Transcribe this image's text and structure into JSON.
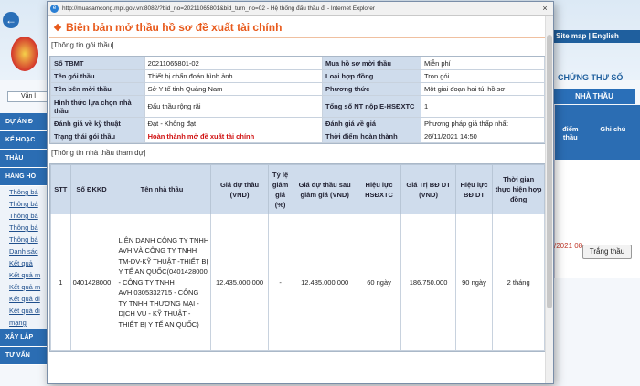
{
  "background": {
    "site_links": "Site map | English",
    "banner_text": "CHỨNG THƯ SỐ",
    "nav_button": "NHÀ THẦU",
    "search_value": "Văn l",
    "left_menu": [
      {
        "label": "DỰ ÁN Đ",
        "type": "head"
      },
      {
        "label": "KẾ HOẠC",
        "type": "head"
      },
      {
        "label": "THẦU",
        "type": "head"
      },
      {
        "label": "HÀNG HÓ",
        "type": "head"
      },
      {
        "label": "Thông bá",
        "type": "sub"
      },
      {
        "label": "Thông bá",
        "type": "sub"
      },
      {
        "label": "Thông bá",
        "type": "sub"
      },
      {
        "label": "Thông bá",
        "type": "sub"
      },
      {
        "label": "Thông bá",
        "type": "sub"
      },
      {
        "label": "Danh sác",
        "type": "sub"
      },
      {
        "label": "Kết quả",
        "type": "sub"
      },
      {
        "label": "Kết quả m",
        "type": "sub"
      },
      {
        "label": "Kết quả m",
        "type": "sub"
      },
      {
        "label": "Kết quả đi",
        "type": "sub"
      },
      {
        "label": "Kết quả đi",
        "type": "sub"
      },
      {
        "label": "mạng",
        "type": "sub"
      },
      {
        "label": "XÂY LẮP",
        "type": "head"
      },
      {
        "label": "TƯ VẤN",
        "type": "head"
      }
    ],
    "right_panel": {
      "col1": "điểm thầu",
      "col2": "Ghi chú",
      "date": "/2021 08",
      "button": "Trắng thầu"
    }
  },
  "window": {
    "title": "http://muasamcong.mpi.gov.vn:8082/?bid_no=20211065801&bid_turn_no=02 - Hệ thống đấu thầu đi - Internet Explorer",
    "close": "×"
  },
  "page_title": "Biên bản mở thầu hồ sơ đề xuất tài chính",
  "package_info": {
    "legend": "[Thông tin gói thầu]",
    "rows": [
      {
        "k1": "Số TBMT",
        "v1": "20211065801-02",
        "k2": "Mua hồ sơ mời thầu",
        "v2": "Miễn phí"
      },
      {
        "k1": "Tên gói thầu",
        "v1": "Thiết bị chẩn đoán hình ảnh",
        "k2": "Loại hợp đồng",
        "v2": "Trọn gói"
      },
      {
        "k1": "Tên bên mời thầu",
        "v1": "Sở Y tế tỉnh Quảng Nam",
        "k2": "Phương thức",
        "v2": "Một giai đoạn hai túi hồ sơ"
      },
      {
        "k1": "Hình thức lựa chọn nhà thầu",
        "v1": "Đấu thầu rộng rãi",
        "k2": "Tổng số NT nộp E-HSĐXTC",
        "v2": "1"
      },
      {
        "k1": "Đánh giá về kỹ thuật",
        "v1": "Đạt - Không đạt",
        "k2": "Đánh giá về giá",
        "v2": "Phương pháp giá thấp nhất"
      },
      {
        "k1": "Trạng thái gói thầu",
        "v1": "Hoàn thành mở đề xuất tài chính",
        "k2": "Thời điểm hoàn thành",
        "v2": "26/11/2021 14:50"
      }
    ]
  },
  "bidder_info": {
    "legend": "[Thông tin nhà thầu tham dự]",
    "headers": [
      "STT",
      "Số ĐKKD",
      "Tên nhà thầu",
      "Giá dự thầu (VND)",
      "Tỷ lệ giảm giá (%)",
      "Giá dự thầu sau giảm giá (VND)",
      "Hiệu lực HSĐXTC",
      "Giá Trị BĐ DT (VND)",
      "Hiệu lực BĐ DT",
      "Thời gian thực hiện hợp đồng"
    ],
    "rows": [
      {
        "stt": "1",
        "dkkd": "0401428000",
        "name": "LIÊN DANH CÔNG TY TNHH AVH VÀ CÔNG TY TNHH TM-DV-KỸ THUẬT -THIẾT BỊ Y TẾ AN QUỐC(0401428000 - CÔNG TY TNHH AVH,0305332715 - CÔNG TY TNHH THƯƠNG MẠI - DỊCH VỤ - KỸ THUẬT - THIẾT BỊ Y TẾ AN QUỐC)",
        "price": "12.435.000.000",
        "discount": "-",
        "price_after": "12.435.000.000",
        "validity": "60 ngày",
        "guarantee": "186.750.000",
        "guarantee_validity": "90 ngày",
        "duration": "2 tháng"
      }
    ]
  }
}
